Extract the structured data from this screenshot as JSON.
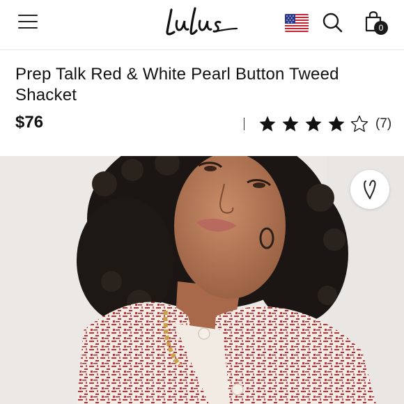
{
  "header": {
    "brand_name": "Lulus",
    "cart_count": "0",
    "icons": {
      "menu": "hamburger-menu-icon",
      "flag": "us-flag-icon",
      "search": "search-icon",
      "bag": "shopping-bag-icon",
      "wishlist": "heart-icon"
    }
  },
  "product": {
    "title": "Prep Talk Red & White Pearl Button Tweed Shacket",
    "price": "$76",
    "rating": 4,
    "rating_max": 5,
    "review_count": "(7)"
  },
  "colors": {
    "text": "#111111",
    "star": "#111111",
    "tweed_red": "#c2303a",
    "tweed_cream": "#f3ece4"
  }
}
